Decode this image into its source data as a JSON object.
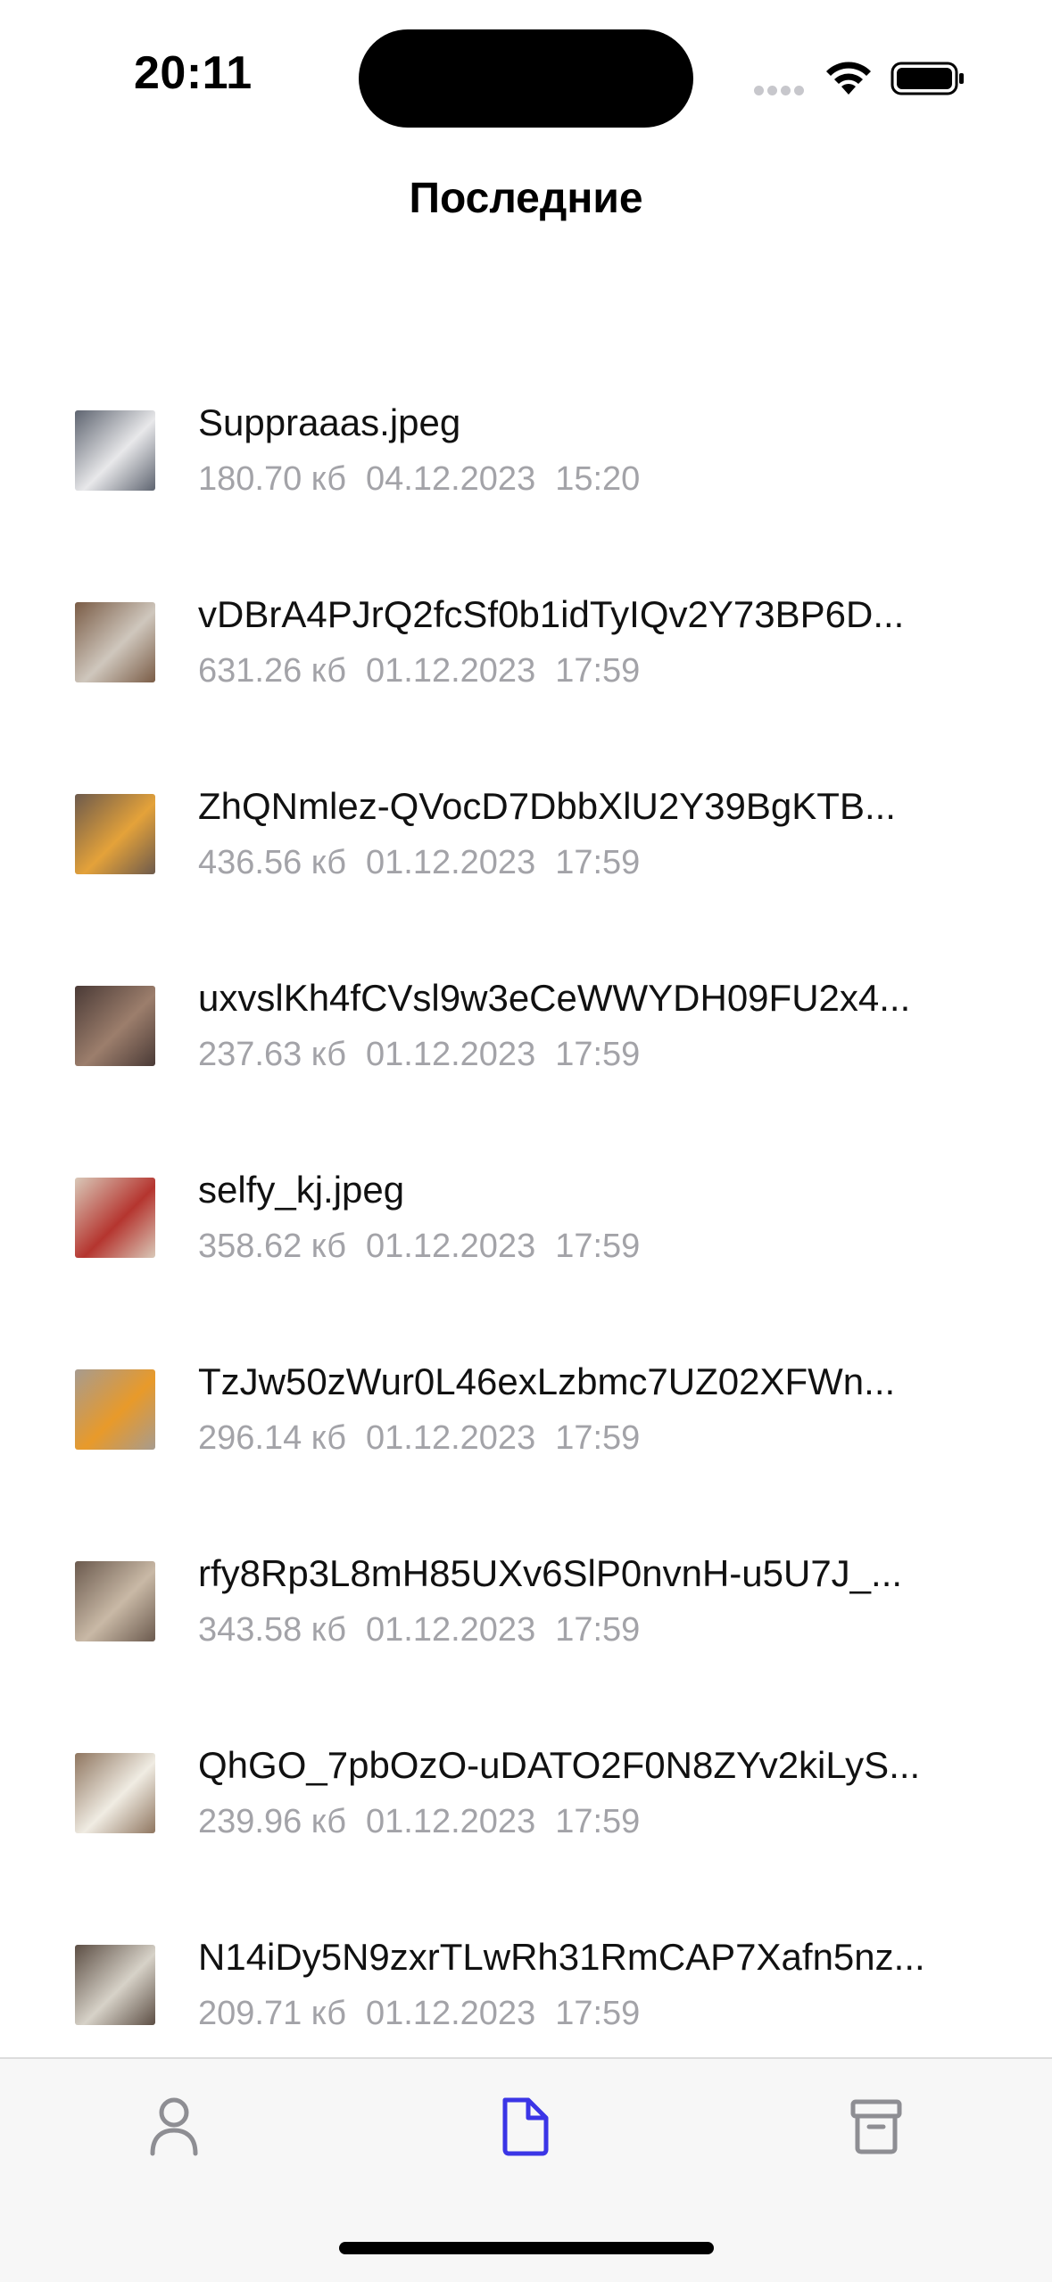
{
  "status_bar": {
    "time": "20:11"
  },
  "header": {
    "title": "Последние"
  },
  "files": [
    {
      "name": "Suppraaas.jpeg",
      "size": "180.70 кб",
      "date": "04.12.2023",
      "time": "15:20",
      "thumb_colors": [
        "#5e6470",
        "#e8e8ea"
      ]
    },
    {
      "name": "vDBrA4PJrQ2fcSf0b1idTyIQv2Y73BP6D...",
      "size": "631.26 кб",
      "date": "01.12.2023",
      "time": "17:59",
      "thumb_colors": [
        "#7a5c46",
        "#cfc7bd"
      ]
    },
    {
      "name": "ZhQNmlez-QVocD7DbbXlU2Y39BgKTB...",
      "size": "436.56 кб",
      "date": "01.12.2023",
      "time": "17:59",
      "thumb_colors": [
        "#6d5a4c",
        "#e4a23a"
      ]
    },
    {
      "name": "uxvslKh4fCVsl9w3eCeWWYDH09FU2x4...",
      "size": "237.63 кб",
      "date": "01.12.2023",
      "time": "17:59",
      "thumb_colors": [
        "#4a3a36",
        "#9c7e6c"
      ]
    },
    {
      "name": "selfy_kj.jpeg",
      "size": "358.62 кб",
      "date": "01.12.2023",
      "time": "17:59",
      "thumb_colors": [
        "#d9c8b8",
        "#b5352f"
      ]
    },
    {
      "name": "TzJw50zWur0L46exLzbmc7UZ02XFWn...",
      "size": "296.14 кб",
      "date": "01.12.2023",
      "time": "17:59",
      "thumb_colors": [
        "#a79b8e",
        "#e89a2a"
      ]
    },
    {
      "name": "rfy8Rp3L8mH85UXv6SlP0nvnH-u5U7J_...",
      "size": "343.58 кб",
      "date": "01.12.2023",
      "time": "17:59",
      "thumb_colors": [
        "#6b5a4e",
        "#c9b9a6"
      ]
    },
    {
      "name": "QhGO_7pbOzO-uDATO2F0N8ZYv2kiLyS...",
      "size": "239.96 кб",
      "date": "01.12.2023",
      "time": "17:59",
      "thumb_colors": [
        "#8f7660",
        "#f0ece3"
      ]
    },
    {
      "name": "N14iDy5N9zxrTLwRh31RmCAP7Xafn5nz...",
      "size": "209.71 кб",
      "date": "01.12.2023",
      "time": "17:59",
      "thumb_colors": [
        "#5c4e44",
        "#d7d2c8"
      ]
    }
  ],
  "tab_bar": {
    "tabs": [
      {
        "icon": "person-icon",
        "active": false
      },
      {
        "icon": "document-icon",
        "active": true
      },
      {
        "icon": "archive-icon",
        "active": false
      }
    ],
    "active_color": "#3b35e6",
    "inactive_color": "#8e8e93"
  }
}
